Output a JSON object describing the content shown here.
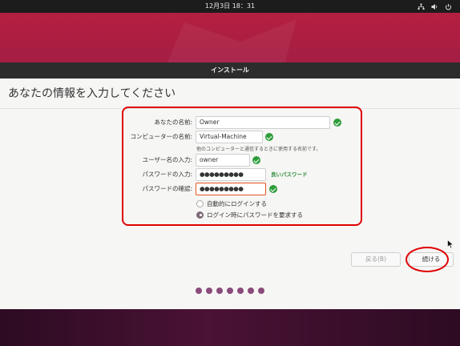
{
  "topbar": {
    "clock": "12月3日  18：31",
    "icons": [
      "network-icon",
      "volume-icon",
      "power-icon"
    ]
  },
  "window": {
    "title": "インストール",
    "heading": "あなたの情報を入力してください"
  },
  "form": {
    "name_label": "あなたの名前:",
    "name_value": "Owner",
    "computer_label": "コンピューターの名前:",
    "computer_value": "Virtual-Machine",
    "computer_hint": "他のコンピューターと通信するときに使用する名前です。",
    "username_label": "ユーザー名の入力:",
    "username_value": "owner",
    "password_label": "パスワードの入力:",
    "password_value": "●●●●●●●●●",
    "password_strength": "良いパスワード",
    "confirm_label": "パスワードの確認:",
    "confirm_value": "●●●●●●●●●",
    "radio_auto_login": "自動的にログインする",
    "radio_require_password": "ログイン時にパスワードを要求する",
    "selected_option": "ログイン時にパスワードを要求する"
  },
  "buttons": {
    "back": "戻る(B)",
    "continue": "続ける"
  },
  "progress": {
    "steps": 7
  },
  "colors": {
    "accent": "#e95420",
    "success": "#2e9d3b",
    "highlight": "#e00000",
    "progress_dot": "#8a4b7c"
  }
}
